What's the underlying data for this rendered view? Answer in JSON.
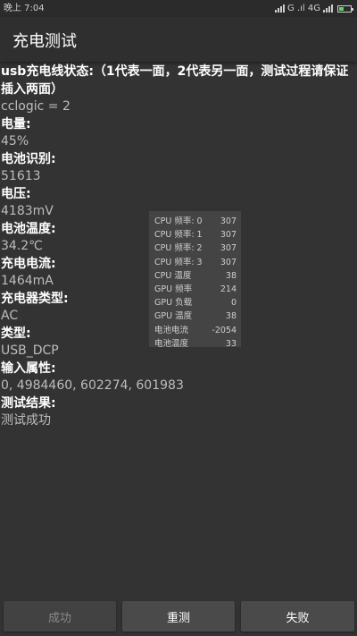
{
  "status_bar": {
    "time": "晚上 7:04",
    "network": "G .ıl 4G",
    "battery_level": 0.45
  },
  "app_bar": {
    "title": "充电测试"
  },
  "fields": [
    {
      "label": "usb充电线状态:（1代表一面，2代表另一面，测试过程请保证插入两面）",
      "value": "cclogic = 2"
    },
    {
      "label": "电量:",
      "value": "45%"
    },
    {
      "label": "电池识别:",
      "value": "51613"
    },
    {
      "label": "电压:",
      "value": "4183mV"
    },
    {
      "label": "电池温度:",
      "value": "34.2℃"
    },
    {
      "label": "充电电流:",
      "value": "1464mA"
    },
    {
      "label": "充电器类型:",
      "value": "AC"
    },
    {
      "label": "类型:",
      "value": "USB_DCP"
    },
    {
      "label": "输入属性:",
      "value": "0, 4984460, 602274, 601983"
    },
    {
      "label": "测试结果:",
      "value": "测试成功"
    }
  ],
  "overlay": {
    "rows": [
      {
        "name": "CPU 频率: 0",
        "value": "307"
      },
      {
        "name": "CPU 频率: 1",
        "value": "307"
      },
      {
        "name": "CPU 频率: 2",
        "value": "307"
      },
      {
        "name": "CPU 频率: 3",
        "value": "307"
      },
      {
        "name": "CPU 温度",
        "value": "38"
      },
      {
        "name": "GPU 频率",
        "value": "214"
      },
      {
        "name": "GPU 负载",
        "value": "0"
      },
      {
        "name": "GPU 温度",
        "value": "38"
      },
      {
        "name": "电池电流",
        "value": "-2054"
      },
      {
        "name": "电池温度",
        "value": "33"
      }
    ]
  },
  "buttons": {
    "success": "成功",
    "retest": "重测",
    "fail": "失败"
  }
}
